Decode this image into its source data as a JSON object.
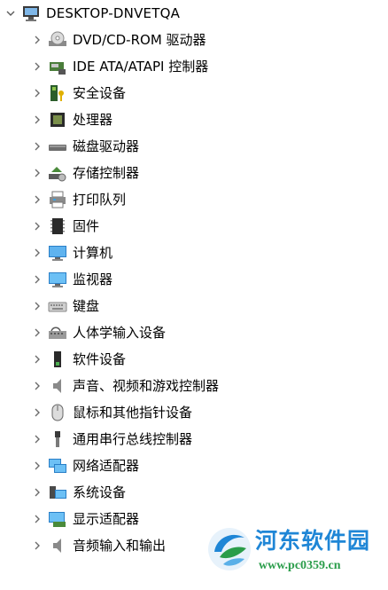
{
  "root": {
    "label": "DESKTOP-DNVETQA",
    "icon": "computer-icon",
    "expanded": true
  },
  "items": [
    {
      "label": "DVD/CD-ROM 驱动器",
      "icon": "dvd-drive-icon"
    },
    {
      "label": "IDE ATA/ATAPI 控制器",
      "icon": "ide-controller-icon"
    },
    {
      "label": "安全设备",
      "icon": "security-device-icon"
    },
    {
      "label": "处理器",
      "icon": "processor-icon"
    },
    {
      "label": "磁盘驱动器",
      "icon": "disk-drive-icon"
    },
    {
      "label": "存储控制器",
      "icon": "storage-controller-icon"
    },
    {
      "label": "打印队列",
      "icon": "printer-icon"
    },
    {
      "label": "固件",
      "icon": "firmware-icon"
    },
    {
      "label": "计算机",
      "icon": "computer-monitor-icon"
    },
    {
      "label": "监视器",
      "icon": "monitor-icon"
    },
    {
      "label": "键盘",
      "icon": "keyboard-icon"
    },
    {
      "label": "人体学输入设备",
      "icon": "hid-icon"
    },
    {
      "label": "软件设备",
      "icon": "software-device-icon"
    },
    {
      "label": "声音、视频和游戏控制器",
      "icon": "speaker-icon"
    },
    {
      "label": "鼠标和其他指针设备",
      "icon": "mouse-icon"
    },
    {
      "label": "通用串行总线控制器",
      "icon": "usb-icon"
    },
    {
      "label": "网络适配器",
      "icon": "network-adapter-icon"
    },
    {
      "label": "系统设备",
      "icon": "system-device-icon"
    },
    {
      "label": "显示适配器",
      "icon": "display-adapter-icon"
    },
    {
      "label": "音频输入和输出",
      "icon": "audio-io-icon"
    }
  ],
  "watermark": {
    "title": "河东软件园",
    "url": "www.pc0359.cn"
  },
  "colors": {
    "chevron": "#6b6b6b",
    "watermark_blue": "#1f86d6",
    "watermark_green": "#2a9d4a"
  }
}
